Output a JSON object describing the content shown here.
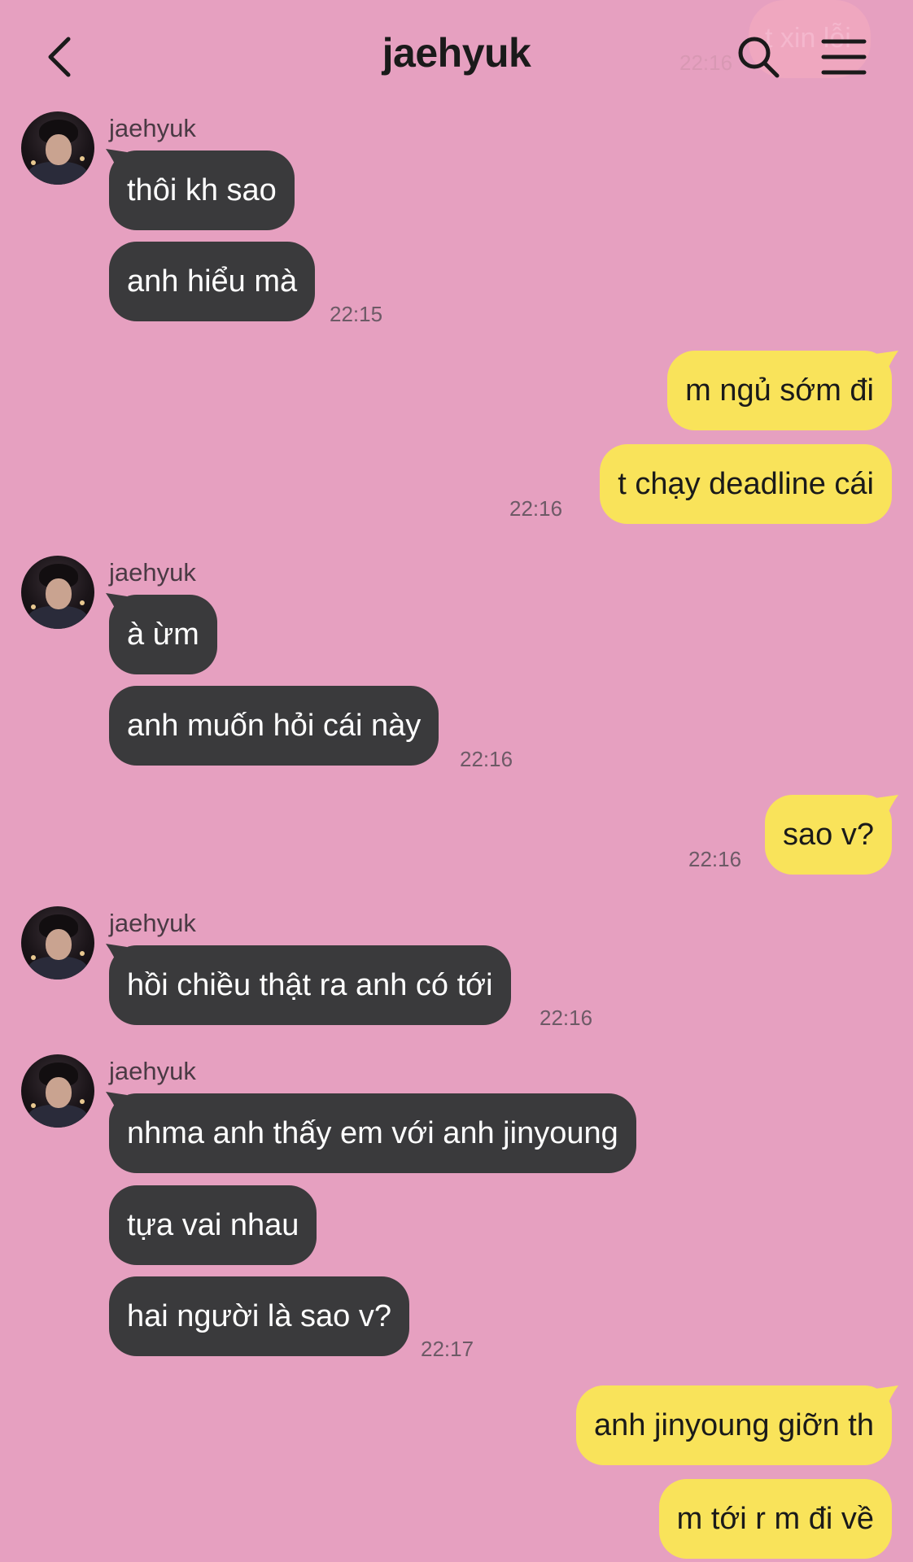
{
  "header": {
    "title": "jaehyuk",
    "back_icon": "chevron-left-icon",
    "search_icon": "search-icon",
    "menu_icon": "hamburger-menu-icon",
    "ghost_text": "t xin lỗi",
    "ghost_time": "22:16"
  },
  "colors": {
    "background": "#e6a0c0",
    "incoming_bubble": "#3a3a3c",
    "outgoing_bubble": "#f9e35a"
  },
  "messages": [
    {
      "from": "jaehyuk",
      "text": "thôi kh sao"
    },
    {
      "from": "jaehyuk",
      "text": "anh hiểu mà",
      "time": "22:15"
    },
    {
      "from": "me",
      "text": "m ngủ sớm đi"
    },
    {
      "from": "me",
      "text": "t chạy deadline cái",
      "time": "22:16"
    },
    {
      "from": "jaehyuk",
      "text": "à ừm"
    },
    {
      "from": "jaehyuk",
      "text": "anh muốn hỏi cái này",
      "time": "22:16"
    },
    {
      "from": "me",
      "text": "sao v?",
      "time": "22:16"
    },
    {
      "from": "jaehyuk",
      "text": "hồi chiều thật ra anh có tới",
      "time": "22:16"
    },
    {
      "from": "jaehyuk",
      "text": "nhma anh thấy em với anh jinyoung"
    },
    {
      "from": "jaehyuk",
      "text": "tựa vai nhau"
    },
    {
      "from": "jaehyuk",
      "text": "hai người là sao v?",
      "time": "22:17"
    },
    {
      "from": "me",
      "text": "anh jinyoung giỡn th"
    },
    {
      "from": "me",
      "text": "m tới r m đi về"
    }
  ]
}
